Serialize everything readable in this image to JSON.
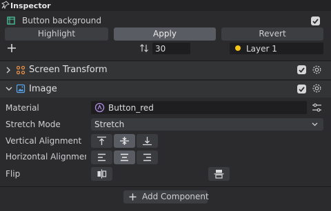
{
  "header": {
    "title": "Inspector"
  },
  "button_background": {
    "label": "Button background",
    "tabs": [
      {
        "label": "Highlight"
      },
      {
        "label": "Apply"
      },
      {
        "label": "Revert"
      }
    ],
    "value": "30",
    "layer": "Layer 1"
  },
  "screen_transform": {
    "title": "Screen Transform"
  },
  "image": {
    "title": "Image",
    "material_label": "Material",
    "material_value": "Button_red",
    "stretch_label": "Stretch Mode",
    "stretch_value": "Stretch",
    "vertical_label": "Vertical Alignment",
    "horizontal_label": "Horizontal Alignment",
    "flip_label": "Flip"
  },
  "add_component": {
    "label": "Add Component"
  },
  "colors": {
    "accent": "#f5c518",
    "panel": "#2b2b2d"
  }
}
